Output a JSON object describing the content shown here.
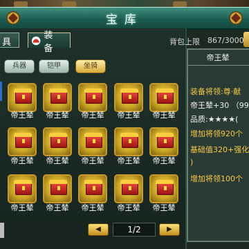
{
  "window": {
    "title": "宝库"
  },
  "tabs": {
    "tools": "具",
    "equip": "装 备"
  },
  "bag": {
    "label": "背包上限",
    "count": "867/3000"
  },
  "filters": [
    {
      "label": "兵器",
      "active": false
    },
    {
      "label": "铠甲",
      "active": false
    },
    {
      "label": "坐骑",
      "active": true
    }
  ],
  "items": [
    "帝王辇",
    "帝王辇",
    "帝王辇",
    "帝王辇",
    "帝王辇",
    "帝王辇",
    "帝王辇",
    "帝王辇",
    "帝王辇",
    "帝王辇",
    "帝王辇",
    "帝王辇",
    "帝王辇",
    "帝王辇",
    "帝王辇"
  ],
  "details": {
    "title": "帝王辇",
    "lines": [
      "装备将领:尊·献",
      "帝王辇+30 （99",
      "品质:★★★★(",
      "增加将领920个",
      "基础值320+强化",
      ")",
      "增加将领100个"
    ]
  },
  "pager": {
    "prev": "◀",
    "next": "▶",
    "page": "1/2"
  },
  "icons": {
    "ornament": "dragon-ornament-icon",
    "equip": "helmet-icon",
    "item": "imperial-carriage-icon"
  },
  "colors": {
    "accent_gold": "#f6c949",
    "title_bar": "#1f5e52"
  }
}
